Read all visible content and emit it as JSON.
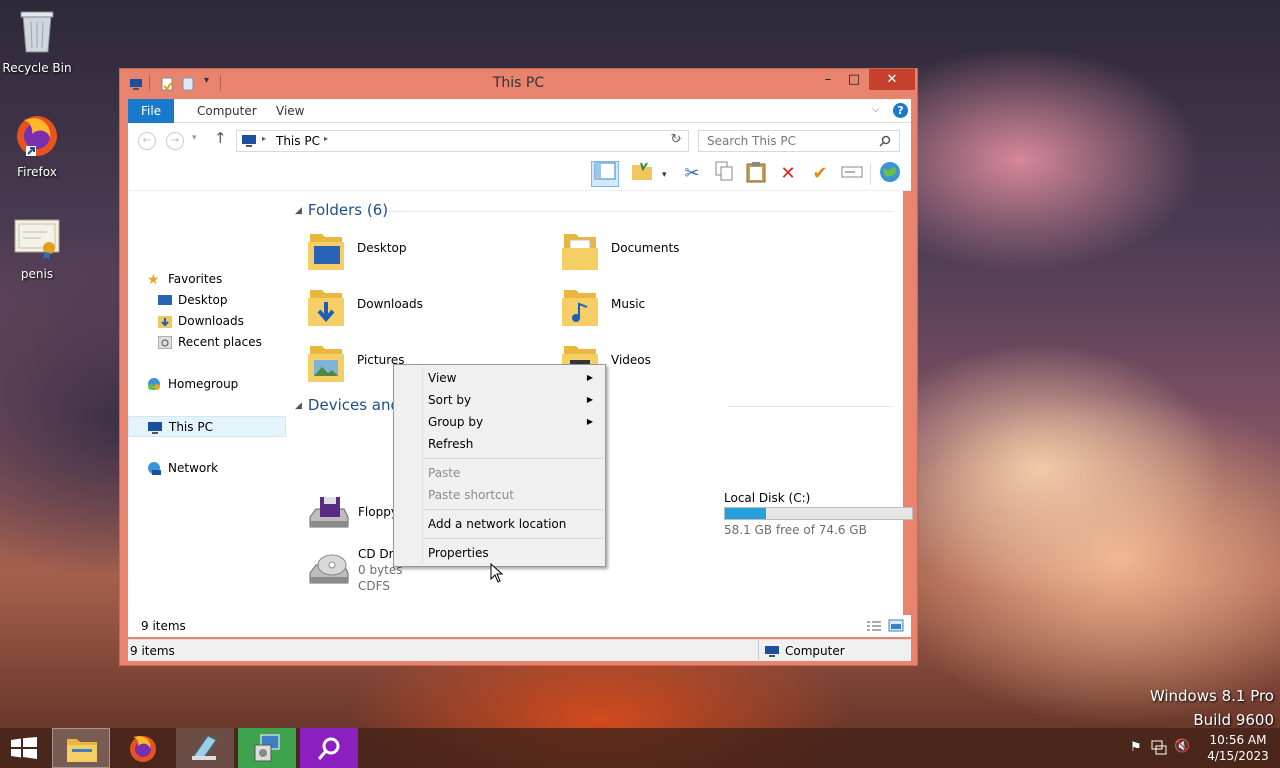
{
  "desktop": {
    "icons": [
      {
        "label": "Recycle Bin"
      },
      {
        "label": "Firefox"
      },
      {
        "label": "penis"
      }
    ]
  },
  "window": {
    "title": "This PC",
    "controls": {
      "minimize": "–",
      "maximize": "□",
      "close": "✕"
    }
  },
  "ribbon": {
    "tabs": [
      "File",
      "Computer",
      "View"
    ]
  },
  "address": {
    "path": "This PC",
    "search_placeholder": "Search This PC"
  },
  "nav": {
    "items": [
      "Favorites",
      "Desktop",
      "Downloads",
      "Recent places",
      "Homegroup",
      "This PC",
      "Network"
    ]
  },
  "folders_group": {
    "title": "Folders (6)",
    "items": [
      "Desktop",
      "Documents",
      "Downloads",
      "Music",
      "Pictures",
      "Videos"
    ]
  },
  "devices_group": {
    "title": "Devices and",
    "floppy": {
      "label": "Floppy"
    },
    "cd": {
      "label": "CD Driv",
      "size": "0 bytes",
      "fs": "CDFS"
    },
    "local_disk": {
      "label": "Local Disk (C:)",
      "free": "58.1 GB free of 74.6 GB",
      "used_fraction": 0.221
    }
  },
  "status": {
    "inner": "9 items",
    "bottom": "9 items",
    "location": "Computer"
  },
  "context_menu": {
    "items": [
      "View",
      "Sort by",
      "Group by",
      "Refresh",
      "Paste",
      "Paste shortcut",
      "Add a network location",
      "Properties"
    ]
  },
  "tray": {
    "time": "10:56 AM",
    "date": "4/15/2023"
  },
  "watermark": {
    "line1": "Windows 8.1 Pro",
    "line2": "Build 9600"
  },
  "colors": {
    "window_frame": "#e8836d",
    "accent": "#1979ca",
    "folder_header": "#1e4e8c",
    "disk_bar": "#26a0da"
  }
}
